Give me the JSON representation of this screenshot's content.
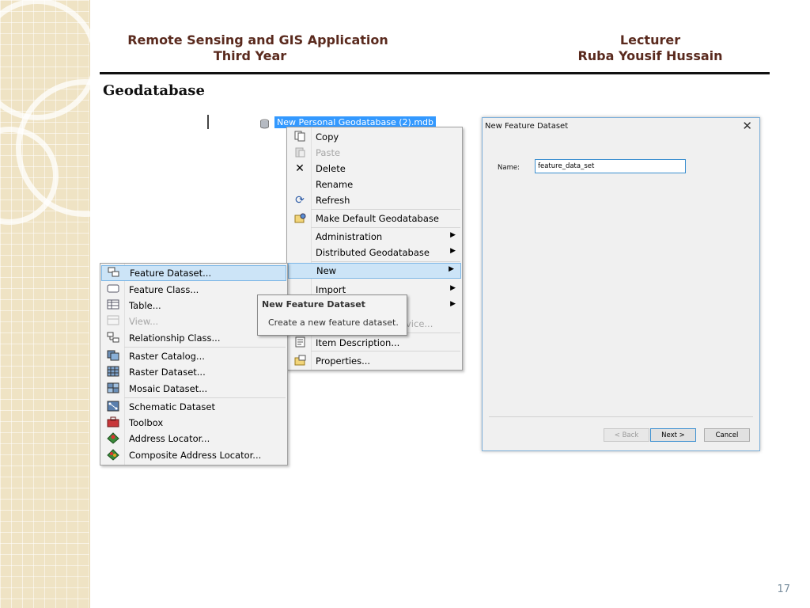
{
  "header": {
    "course_line1": "Remote Sensing and GIS Application",
    "course_line2": "Third Year",
    "lecturer_label": "Lecturer",
    "lecturer_name": "Ruba Yousif Hussain"
  },
  "slide_title": "Geodatabase",
  "tree_item": {
    "label": "New Personal Geodatabase (2).mdb",
    "icon": "database-icon"
  },
  "context_menu": {
    "items": [
      {
        "label": "Copy",
        "icon": "copy-icon"
      },
      {
        "label": "Paste",
        "icon": "paste-icon",
        "disabled": true
      },
      {
        "label": "Delete",
        "icon": "delete-icon"
      },
      {
        "label": "Rename",
        "icon": ""
      },
      {
        "label": "Refresh",
        "icon": "refresh-icon"
      },
      {
        "label": "Make Default Geodatabase",
        "icon": "default-geodatabase-icon"
      },
      {
        "label": "Administration",
        "icon": ""
      },
      {
        "label": "Distributed Geodatabase",
        "icon": ""
      },
      {
        "label": "New",
        "icon": ""
      },
      {
        "label": "Import",
        "icon": ""
      },
      {
        "label": "vice...",
        "icon": ""
      },
      {
        "label": "Item Description...",
        "icon": "item-description-icon"
      },
      {
        "label": "Properties...",
        "icon": "properties-icon"
      }
    ]
  },
  "new_submenu": {
    "items": [
      {
        "label": "Feature Dataset...",
        "icon": "feature-dataset-icon"
      },
      {
        "label": "Feature Class...",
        "icon": "feature-class-icon"
      },
      {
        "label": "Table...",
        "icon": "table-icon"
      },
      {
        "label": "View...",
        "icon": "view-icon",
        "disabled": true
      },
      {
        "label": "Relationship Class...",
        "icon": "relationship-class-icon"
      },
      {
        "label": "Raster Catalog...",
        "icon": "raster-catalog-icon"
      },
      {
        "label": "Raster Dataset...",
        "icon": "raster-dataset-icon"
      },
      {
        "label": "Mosaic Dataset...",
        "icon": "mosaic-dataset-icon"
      },
      {
        "label": "Schematic Dataset",
        "icon": "schematic-dataset-icon"
      },
      {
        "label": "Toolbox",
        "icon": "toolbox-icon"
      },
      {
        "label": "Address Locator...",
        "icon": "address-locator-icon"
      },
      {
        "label": "Composite Address Locator...",
        "icon": "composite-address-locator-icon"
      }
    ]
  },
  "tooltip": {
    "title": "New Feature Dataset",
    "description": "Create a new feature dataset."
  },
  "dialog": {
    "title": "New Feature Dataset",
    "name_label": "Name:",
    "name_value": "feature_data_set",
    "back_label": "< Back",
    "next_label": "Next >",
    "cancel_label": "Cancel"
  },
  "page_number": "17",
  "colors": {
    "header_text": "#5a2a1e",
    "highlight": "#cce4f7",
    "sidebar": "#efe3c4"
  }
}
